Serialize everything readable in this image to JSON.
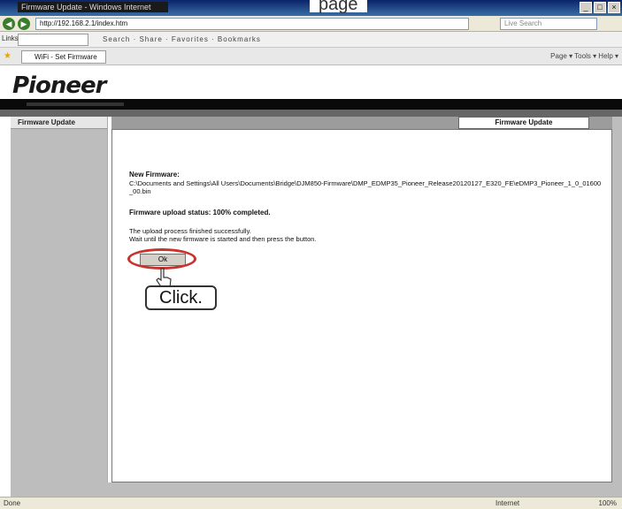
{
  "window": {
    "title": "Firmware Update - Windows Internet Explorer",
    "page_heading": "page"
  },
  "browser": {
    "address": "http://192.168.2.1/index.htm",
    "search_placeholder": "Live Search",
    "links_label": "Links",
    "toolbar_items": "Search · Share · Favorites · Bookmarks",
    "tab_label": "WiFi - Set Firmware",
    "tab_tools": "Page ▾  Tools ▾  Help ▾",
    "status_left": "Done",
    "status_zone": "Internet",
    "status_zoom": "100%"
  },
  "brand": {
    "logo": "Pioneer"
  },
  "sidebar": {
    "items": [
      {
        "label": "Firmware Update"
      }
    ]
  },
  "header": {
    "tab_label": "Firmware Update"
  },
  "main": {
    "new_firmware_label": "New Firmware:",
    "firmware_path": "C:\\Documents and Settings\\All Users\\Documents\\Bridge\\DJM850-Firmware\\DMP_EDMP35_Pioneer_Release20120127_E320_FE\\eDMP3_Pioneer_1_0_01600_00.bin",
    "status": "Firmware upload status: 100% completed.",
    "message_line1": "The upload process finished successfully.",
    "message_line2": "Wait until the new firmware is started and then press the button.",
    "ok_label": "Ok"
  },
  "annotation": {
    "callout": "Click."
  }
}
